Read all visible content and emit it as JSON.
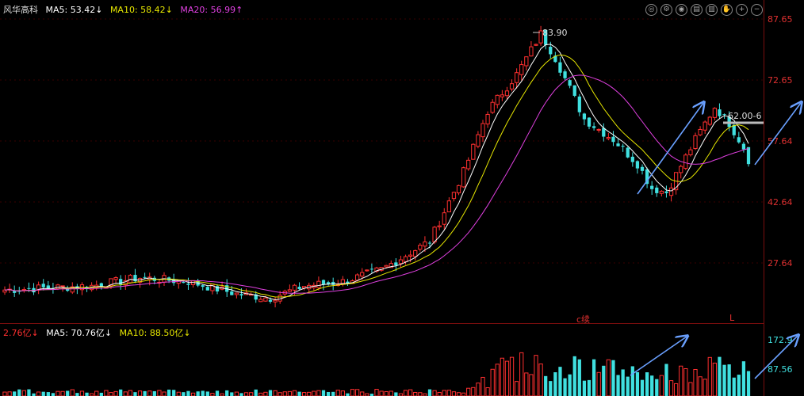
{
  "header": {
    "name": "风华高科",
    "ma5": "MA5: 53.42↓",
    "ma10": "MA10: 58.42↓",
    "ma20": "MA20: 56.99↑",
    "colors": {
      "name": "#dddddd",
      "ma5": "#ffffff",
      "ma10": "#e6e600",
      "ma20": "#e040e0"
    }
  },
  "volume_header": {
    "vol": "2.76亿↓",
    "ma5": "MA5: 70.76亿↓",
    "ma10": "MA10: 88.50亿↓"
  },
  "price_axis": [
    "87.65",
    "72.65",
    "57.64",
    "42.64",
    "27.64"
  ],
  "volume_axis": [
    "172.9",
    "87.56"
  ],
  "annotations": {
    "high": "83.90",
    "line_label": "62.00-6",
    "flag_left": "c续",
    "flag_right": "L"
  },
  "toolbar_icons": [
    "target-icon",
    "settings-icon",
    "eye-icon",
    "print-icon",
    "copy-icon",
    "hand-icon",
    "zoom-in-icon",
    "zoom-out-icon"
  ],
  "toolbar_glyphs": [
    "◎",
    "⚙",
    "◉",
    "▤",
    "▥",
    "✋",
    "+",
    "−"
  ],
  "chart_data": {
    "type": "candlestick",
    "colors": {
      "up": "#ff3030",
      "down": "#40e0e0",
      "ma5": "#ffffff",
      "ma10": "#e6e600",
      "ma20": "#e040e0",
      "arrow": "#6aa0ff"
    },
    "price_range": [
      15,
      92
    ],
    "volume_range": [
      0,
      185
    ]
  }
}
